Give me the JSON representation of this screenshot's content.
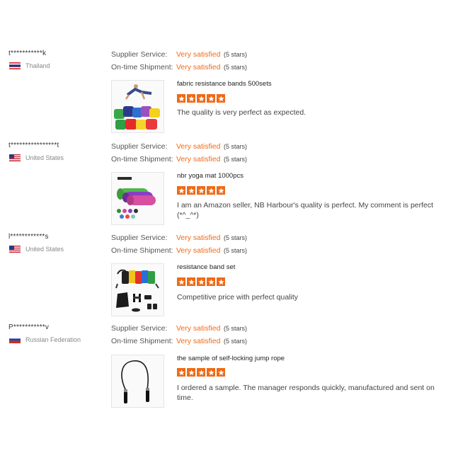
{
  "reviews": [
    {
      "user": "t***********k",
      "country": "Thailand",
      "supplier_label": "Supplier Service:",
      "supplier_value": "Very satisfied",
      "supplier_stars": "(5 stars)",
      "shipment_label": "On-time Shipment:",
      "shipment_value": "Very satisfied",
      "shipment_stars": "(5 stars)",
      "product_title": "fabric resistance bands 500sets",
      "rating": 5,
      "comment": "The quality is very perfect as expected."
    },
    {
      "user": "t****************t",
      "country": "United States",
      "supplier_label": "Supplier Service:",
      "supplier_value": "Very satisfied",
      "supplier_stars": "(5 stars)",
      "shipment_label": "On-time Shipment:",
      "shipment_value": "Very satisfied",
      "shipment_stars": "(5 stars)",
      "product_title": "nbr yoga mat 1000pcs",
      "rating": 5,
      "comment": "I am an Amazon seller, NB Harbour's quality is perfect. My comment is perfect (*^_^*)"
    },
    {
      "user": "l************s",
      "country": "United States",
      "supplier_label": "Supplier Service:",
      "supplier_value": "Very satisfied",
      "supplier_stars": "(5 stars)",
      "shipment_label": "On-time Shipment:",
      "shipment_value": "Very satisfied",
      "shipment_stars": "(5 stars)",
      "product_title": "resistance band set",
      "rating": 5,
      "comment": "Competitive price with perfect quality"
    },
    {
      "user": "P***********v",
      "country": "Russian Federation",
      "supplier_label": "Supplier Service:",
      "supplier_value": "Very satisfied",
      "supplier_stars": "(5 stars)",
      "shipment_label": "On-time Shipment:",
      "shipment_value": "Very satisfied",
      "shipment_stars": "(5 stars)",
      "product_title": "the sample of self-locking jump rope",
      "rating": 5,
      "comment": "I ordered a sample. The manager responds quickly, manufactured and sent on time."
    }
  ],
  "colors": {
    "accent": "#f06a16",
    "star_bg": "#ef6a17"
  }
}
